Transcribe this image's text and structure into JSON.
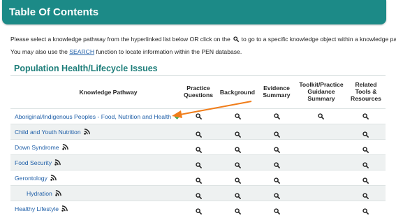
{
  "header": {
    "title": "Table Of Contents",
    "color": "#1c8a87"
  },
  "intro": {
    "line1_before": "Please select a knowledge pathway from the hyperlinked list below OR click on the",
    "line1_after": "to go to a specific knowledge object within a knowledge pathway.",
    "line2_before": "You may also use the",
    "line2_link": "SEARCH",
    "line2_after": "function to locate information within the PEN database."
  },
  "section": {
    "title": "Population Health/Lifecycle Issues"
  },
  "columns": {
    "pathway": "Knowledge Pathway",
    "practice_questions": [
      "Practice",
      "Questions"
    ],
    "background": "Background",
    "evidence_summary": [
      "Evidence",
      "Summary"
    ],
    "toolkit": [
      "Toolkit/Practice",
      "Guidance",
      "Summary"
    ],
    "related": [
      "Related",
      "Tools &",
      "Resources"
    ]
  },
  "rows": [
    {
      "label": "Aboriginal/Indigenous Peoples - Food, Nutrition and Health",
      "rss": false,
      "checked": true,
      "indent": false,
      "pq": true,
      "bg": true,
      "es": true,
      "tk": true,
      "rt": true
    },
    {
      "label": "Child and Youth Nutrition",
      "rss": true,
      "checked": false,
      "indent": false,
      "pq": true,
      "bg": true,
      "es": true,
      "tk": false,
      "rt": true
    },
    {
      "label": "Down Syndrome",
      "rss": true,
      "checked": false,
      "indent": false,
      "pq": true,
      "bg": true,
      "es": true,
      "tk": false,
      "rt": true
    },
    {
      "label": "Food Security",
      "rss": true,
      "checked": false,
      "indent": false,
      "pq": true,
      "bg": true,
      "es": true,
      "tk": false,
      "rt": true
    },
    {
      "label": "Gerontology",
      "rss": true,
      "checked": false,
      "indent": false,
      "pq": true,
      "bg": true,
      "es": true,
      "tk": false,
      "rt": true
    },
    {
      "label": "Hydration",
      "rss": true,
      "checked": false,
      "indent": true,
      "pq": true,
      "bg": true,
      "es": true,
      "tk": false,
      "rt": true
    },
    {
      "label": "Healthy Lifestyle",
      "rss": true,
      "checked": false,
      "indent": false,
      "pq": true,
      "bg": true,
      "es": true,
      "tk": false,
      "rt": true
    }
  ],
  "colors": {
    "link": "#1f5fa8",
    "section": "#1e7e7a",
    "check": "#3aa64a",
    "arrow": "#f07d1a",
    "alt_row": "#eef1f1"
  },
  "icons": {
    "search": "magnifier-icon",
    "rss": "rss-feed-icon",
    "check": "checkmark-icon"
  }
}
